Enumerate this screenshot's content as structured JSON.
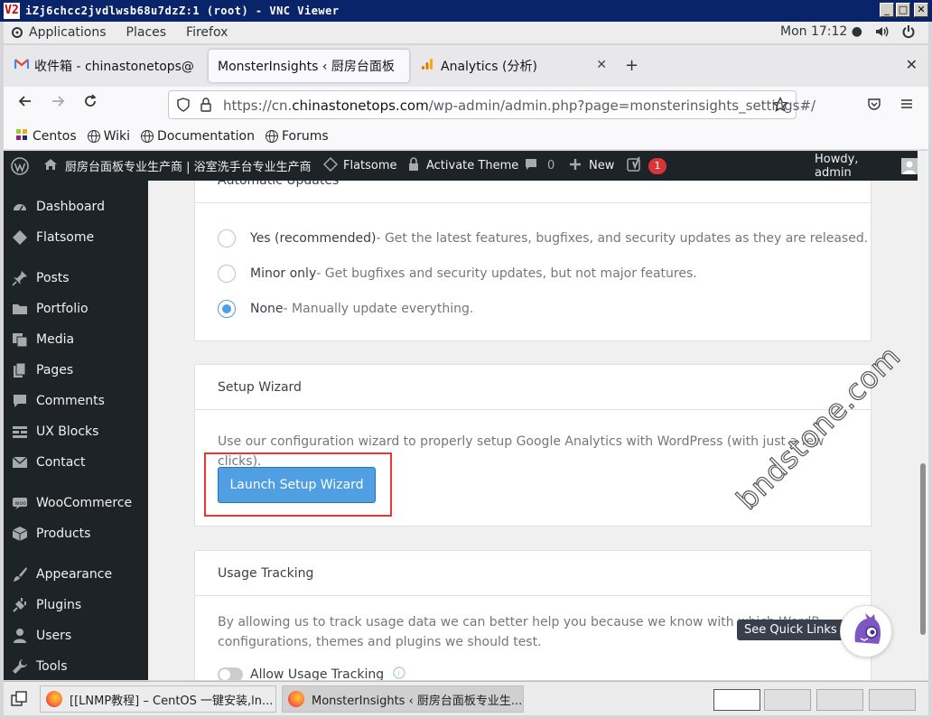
{
  "vnc": {
    "title": "iZj6chcc2jvdlwsb68u7dzZ:1 (root) - VNC Viewer",
    "logo": "V2",
    "min": "_",
    "max": "□",
    "close": "✕"
  },
  "gnome": {
    "applications": "Applications",
    "places": "Places",
    "firefox": "Firefox",
    "clock": "Mon 17:12 ●"
  },
  "tabs": [
    {
      "label": "收件箱 - chinastonetops@",
      "icon": "gmail-icon"
    },
    {
      "label": "MonsterInsights ‹ 厨房台面板",
      "icon": "none"
    },
    {
      "label": "Analytics (分析)",
      "icon": "analytics-icon"
    }
  ],
  "tab_close": "✕",
  "tab_new": "+",
  "nav": {
    "url_prefix": "https://cn.",
    "url_domain": "chinastonetops.com",
    "url_path": "/wp-admin/admin.php?page=monsterinsights_settings#/"
  },
  "bookmarks": [
    "Centos",
    "Wiki",
    "Documentation",
    "Forums"
  ],
  "adminbar": {
    "site_name": "厨房台面板专业生产商 | 浴室洗手台专业生产商",
    "flatsome": "Flatsome",
    "activate_theme": "Activate Theme",
    "comments_count": "0",
    "new": "New",
    "updates_badge": "1",
    "howdy": "Howdy, admin"
  },
  "sidebar": {
    "items": [
      {
        "label": "Dashboard",
        "icon": "dashboard-icon"
      },
      {
        "label": "Flatsome",
        "icon": "flatsome-icon"
      },
      {
        "label": "Posts",
        "icon": "pin-icon"
      },
      {
        "label": "Portfolio",
        "icon": "folder-icon"
      },
      {
        "label": "Media",
        "icon": "media-icon"
      },
      {
        "label": "Pages",
        "icon": "pages-icon"
      },
      {
        "label": "Comments",
        "icon": "comment-icon"
      },
      {
        "label": "UX Blocks",
        "icon": "blocks-icon"
      },
      {
        "label": "Contact",
        "icon": "mail-icon"
      },
      {
        "label": "WooCommerce",
        "icon": "woo-icon"
      },
      {
        "label": "Products",
        "icon": "box-icon"
      },
      {
        "label": "Appearance",
        "icon": "brush-icon"
      },
      {
        "label": "Plugins",
        "icon": "plug-icon"
      },
      {
        "label": "Users",
        "icon": "user-icon"
      },
      {
        "label": "Tools",
        "icon": "wrench-icon"
      }
    ]
  },
  "auto_updates": {
    "title_partial": "Automatic Updates",
    "options": [
      {
        "label": "Yes (recommended)",
        "desc": " - Get the latest features, bugfixes, and security updates as they are released.",
        "checked": false
      },
      {
        "label": "Minor only",
        "desc": " - Get bugfixes and security updates, but not major features.",
        "checked": false
      },
      {
        "label": "None",
        "desc": " - Manually update everything.",
        "checked": true
      }
    ]
  },
  "setup_wizard": {
    "title": "Setup Wizard",
    "desc": "Use our configuration wizard to properly setup Google Analytics with WordPress (with just a few clicks).",
    "button": "Launch Setup Wizard"
  },
  "usage_tracking": {
    "title": "Usage Tracking",
    "desc_line1": "By allowing us to track usage data we can better help you because we know with which WordP",
    "desc_line2": "configurations, themes and plugins we should test.",
    "toggle_label": "Allow Usage Tracking",
    "enabled": false
  },
  "quick_links": "See Quick Links",
  "watermark": "bndstone.com",
  "taskbar": {
    "tasks": [
      "[[LNMP教程] – CentOS 一键安装,ln...",
      "MonsterInsights ‹ 厨房台面板专业生..."
    ]
  }
}
